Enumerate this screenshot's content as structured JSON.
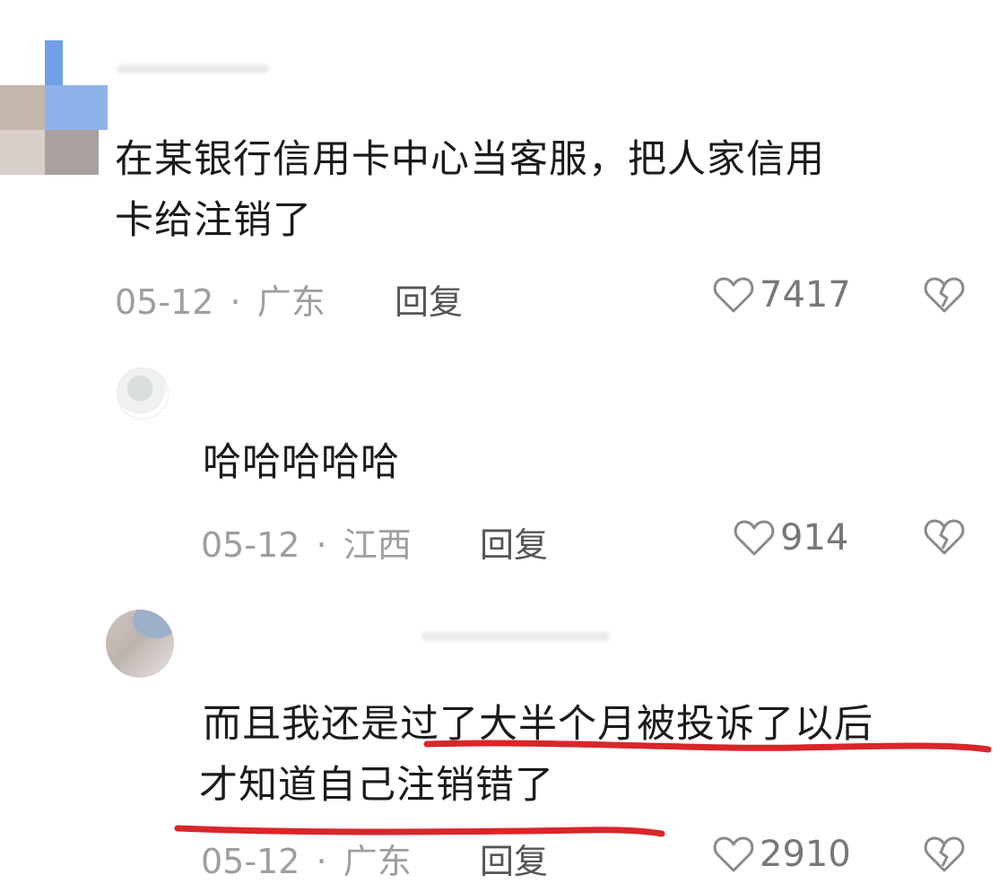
{
  "comments": [
    {
      "text_line1": "在某银行信用卡中心当客服，把人家信用",
      "text_line2": "卡给注销了",
      "date": "05-12",
      "sep": "·",
      "location": "广东",
      "reply_label": "回复",
      "likes": "7417"
    },
    {
      "text_line1": "哈哈哈哈哈",
      "date": "05-12",
      "sep": "·",
      "location": "江西",
      "reply_label": "回复",
      "likes": "914"
    },
    {
      "text_part1": "而且我还是",
      "text_part2": "过了大半个月被投诉了以后",
      "text_line2": "才知道自己注销错了",
      "date": "05-12",
      "sep": "·",
      "location": "广东",
      "reply_label": "回复",
      "likes": "2910"
    }
  ],
  "colors": {
    "underline": "#d9262b",
    "meta": "#9e9e9e",
    "text": "#1b1b1b"
  },
  "icons": [
    "heart-outline-icon",
    "broken-heart-icon"
  ]
}
